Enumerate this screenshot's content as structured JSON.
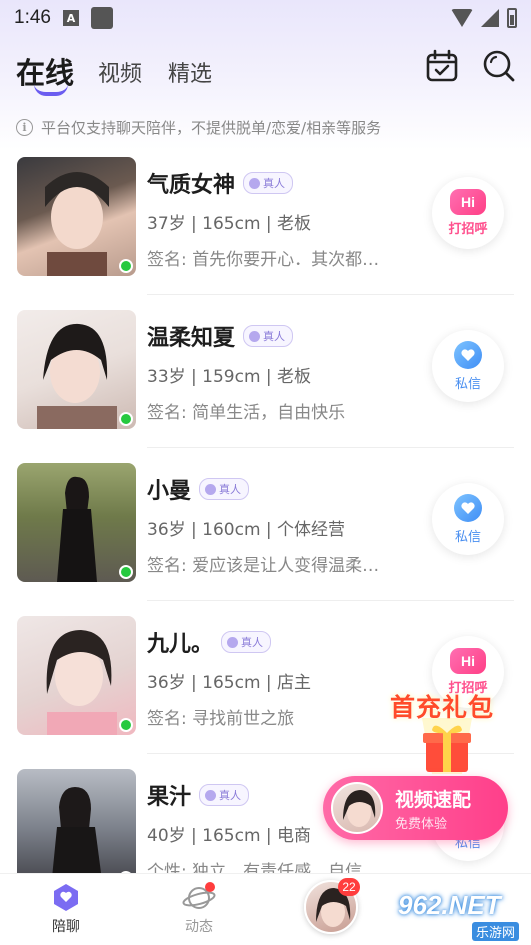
{
  "status_bar": {
    "time": "1:46",
    "a_icon": "A"
  },
  "header": {
    "tabs": [
      {
        "label": "在线",
        "active": true
      },
      {
        "label": "视频",
        "active": false
      },
      {
        "label": "精选",
        "active": false
      }
    ],
    "icons": [
      "calendar-check-icon",
      "search-icon"
    ]
  },
  "notice": "平台仅支持聊天陪伴，不提供脱单/恋爱/相亲等服务",
  "users": [
    {
      "name": "气质女神",
      "badge": "真人",
      "meta": "37岁 | 165cm | 老板",
      "sign": "签名: 首先你要开心．其次都…",
      "action": "打招呼",
      "action_type": "hi"
    },
    {
      "name": "温柔知夏",
      "badge": "真人",
      "meta": "33岁 | 159cm | 老板",
      "sign": "签名: 简单生活，自由快乐",
      "action": "私信",
      "action_type": "chat"
    },
    {
      "name": "小曼",
      "badge": "真人",
      "meta": "36岁 | 160cm | 个体经营",
      "sign": "签名: 爱应该是让人变得温柔…",
      "action": "私信",
      "action_type": "chat"
    },
    {
      "name": "九儿。",
      "badge": "真人",
      "meta": "36岁 | 165cm | 店主",
      "sign": "签名: 寻找前世之旅",
      "action": "打招呼",
      "action_type": "hi"
    },
    {
      "name": "果汁",
      "badge": "真人",
      "meta": "40岁 | 165cm | 电商",
      "sign": "个性: 独立、有责任感、自信…",
      "action": "私信",
      "action_type": "chat"
    }
  ],
  "hi_text": "Hi",
  "promo": {
    "title": "首充礼包",
    "speed_title": "视频速配",
    "speed_sub": "免费体验"
  },
  "bottom_nav": {
    "items": [
      {
        "label": "陪聊",
        "active": true
      },
      {
        "label": "动态",
        "active": false
      }
    ],
    "center_count": "22"
  },
  "watermark": {
    "main": "962.NET",
    "sub": "乐游网"
  }
}
